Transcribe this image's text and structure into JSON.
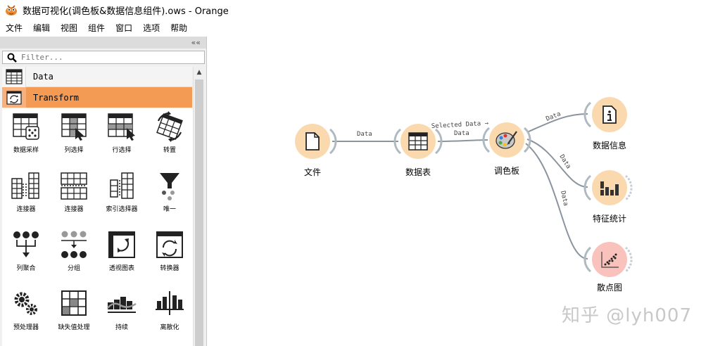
{
  "window": {
    "title": "数据可视化(调色板&数据信息组件).ows - Orange"
  },
  "menu": [
    "文件",
    "编辑",
    "视图",
    "组件",
    "窗口",
    "选项",
    "帮助"
  ],
  "dock": {
    "collapse": "««",
    "filter_placeholder": "Filter...",
    "categories": [
      {
        "label": "Data",
        "icon": "table-icon"
      },
      {
        "label": "Transform",
        "icon": "transform-icon",
        "color": "#f39a55"
      }
    ],
    "widgets": [
      {
        "label": "数据采样",
        "icon": "data-sampler-icon"
      },
      {
        "label": "列选择",
        "icon": "select-columns-icon"
      },
      {
        "label": "行选择",
        "icon": "select-rows-icon"
      },
      {
        "label": "转置",
        "icon": "transpose-icon"
      },
      {
        "label": "连接器",
        "icon": "merge-data-icon"
      },
      {
        "label": "连接器",
        "icon": "concatenate-icon"
      },
      {
        "label": "索引选择器",
        "icon": "select-by-index-icon"
      },
      {
        "label": "唯一",
        "icon": "unique-icon"
      },
      {
        "label": "列聚合",
        "icon": "aggregate-columns-icon"
      },
      {
        "label": "分组",
        "icon": "group-by-icon"
      },
      {
        "label": "透视图表",
        "icon": "pivot-table-icon"
      },
      {
        "label": "转换器",
        "icon": "apply-domain-icon"
      },
      {
        "label": "预处理器",
        "icon": "preprocess-icon"
      },
      {
        "label": "缺失值处理",
        "icon": "impute-icon"
      },
      {
        "label": "持续",
        "icon": "continuize-icon"
      },
      {
        "label": "离散化",
        "icon": "discretize-icon"
      }
    ]
  },
  "canvas": {
    "nodes": [
      {
        "id": "file",
        "label": "文件",
        "icon": "file-icon",
        "color": "#fbd9ae"
      },
      {
        "id": "table",
        "label": "数据表",
        "icon": "table-icon",
        "color": "#fbd9ae"
      },
      {
        "id": "palette",
        "label": "调色板",
        "icon": "palette-icon",
        "color": "#fbd9ae"
      },
      {
        "id": "info",
        "label": "数据信息",
        "icon": "info-icon",
        "color": "#fbd9ae"
      },
      {
        "id": "stats",
        "label": "特征统计",
        "icon": "bar-chart-icon",
        "color": "#fbd9ae"
      },
      {
        "id": "scatter",
        "label": "散点图",
        "icon": "scatter-plot-icon",
        "color": "#f9c2bc"
      }
    ],
    "links": [
      {
        "label": "Data"
      },
      {
        "label": "Selected Data →",
        "sublabel": "Data"
      },
      {
        "label": "Data"
      },
      {
        "label": "Data"
      },
      {
        "label": "Data"
      }
    ]
  },
  "watermark": "知乎 @lyh007"
}
